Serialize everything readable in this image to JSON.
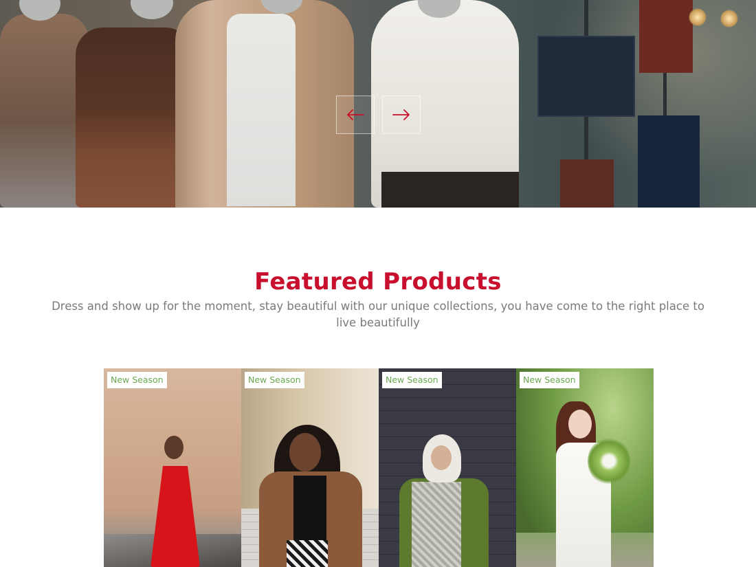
{
  "hero": {
    "prev_label": "←",
    "next_label": "→",
    "accent_color": "#c8102e"
  },
  "featured": {
    "title": "Featured Products",
    "subtitle": "Dress and show up for the moment, stay beautiful with our unique collections, you have come to the right place to live beautifully"
  },
  "products": [
    {
      "badge": "New Season"
    },
    {
      "badge": "New Season"
    },
    {
      "badge": "New Season"
    },
    {
      "badge": "New Season"
    }
  ],
  "colors": {
    "title": "#c8102e",
    "badge_text": "#6aa84f",
    "subtitle": "#7a7a7a"
  }
}
